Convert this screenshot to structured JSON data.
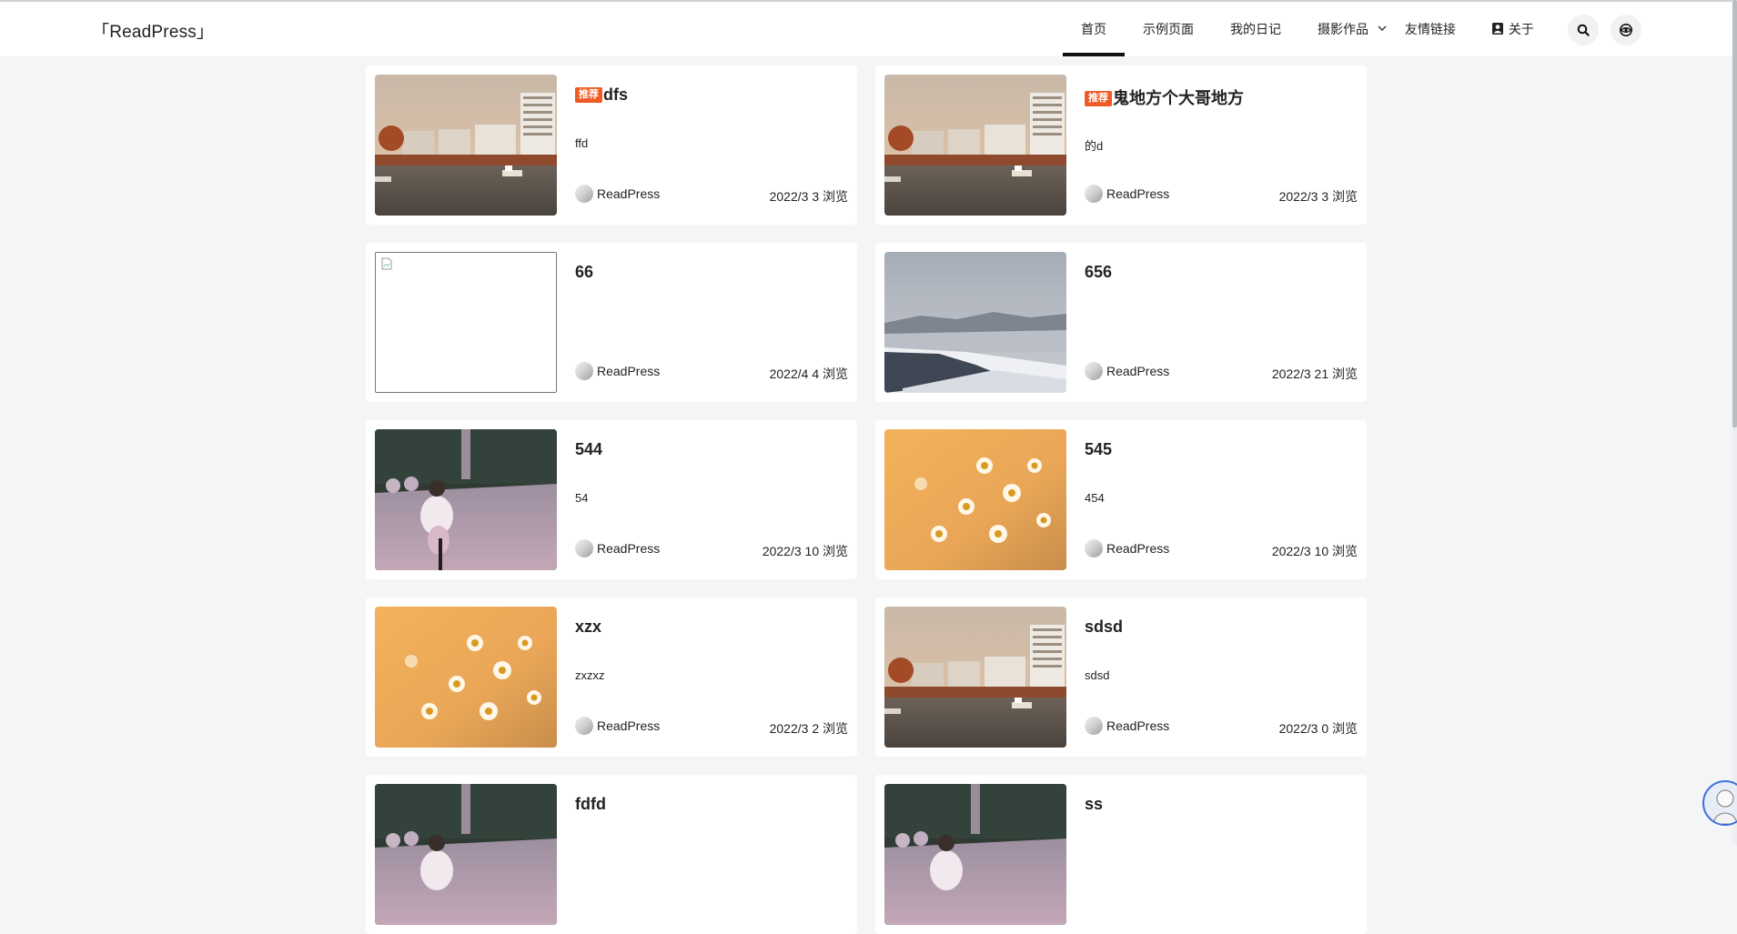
{
  "header": {
    "logo": "「ReadPress」",
    "nav": [
      {
        "label": "首页",
        "active": true
      },
      {
        "label": "示例页面"
      },
      {
        "label": "我的日记"
      },
      {
        "label": "摄影作品",
        "has_dropdown": true
      },
      {
        "label": "友情链接"
      },
      {
        "label": "关于",
        "icon": "user-square-icon"
      }
    ],
    "buttons": [
      {
        "icon": "search-icon"
      },
      {
        "icon": "eye-icon"
      }
    ]
  },
  "posts": [
    {
      "badge": "推荐",
      "title": "dfs",
      "excerpt": "ffd",
      "author": "ReadPress",
      "date": "2022/3",
      "views": "3 浏览",
      "image": "harbor-sunset"
    },
    {
      "badge": "推荐",
      "title": "鬼地方个大哥地方",
      "excerpt": "的d",
      "author": "ReadPress",
      "date": "2022/3",
      "views": "3 浏览",
      "image": "harbor-sunset"
    },
    {
      "badge": "",
      "title": "66",
      "excerpt": "",
      "author": "ReadPress",
      "date": "2022/4",
      "views": "4 浏览",
      "image": "broken"
    },
    {
      "badge": "",
      "title": "656",
      "excerpt": "",
      "author": "ReadPress",
      "date": "2022/3",
      "views": "21 浏览",
      "image": "snowy-river"
    },
    {
      "badge": "",
      "title": "544",
      "excerpt": "54",
      "author": "ReadPress",
      "date": "2022/3",
      "views": "10 浏览",
      "image": "cyclist"
    },
    {
      "badge": "",
      "title": "545",
      "excerpt": "454",
      "author": "ReadPress",
      "date": "2022/3",
      "views": "10 浏览",
      "image": "flowers"
    },
    {
      "badge": "",
      "title": "xzx",
      "excerpt": "zxzxz",
      "author": "ReadPress",
      "date": "2022/3",
      "views": "2 浏览",
      "image": "flowers"
    },
    {
      "badge": "",
      "title": "sdsd",
      "excerpt": "sdsd",
      "author": "ReadPress",
      "date": "2022/3",
      "views": "0 浏览",
      "image": "harbor-sunset"
    },
    {
      "badge": "",
      "title": "fdfd",
      "excerpt": "",
      "author": "",
      "date": "",
      "views": "",
      "image": "cyclist"
    },
    {
      "badge": "",
      "title": "ss",
      "excerpt": "",
      "author": "",
      "date": "",
      "views": "",
      "image": "cyclist"
    }
  ],
  "colors": {
    "badge": "#ef5b25",
    "background": "#f4f5f7",
    "active_underline": "#111111"
  }
}
